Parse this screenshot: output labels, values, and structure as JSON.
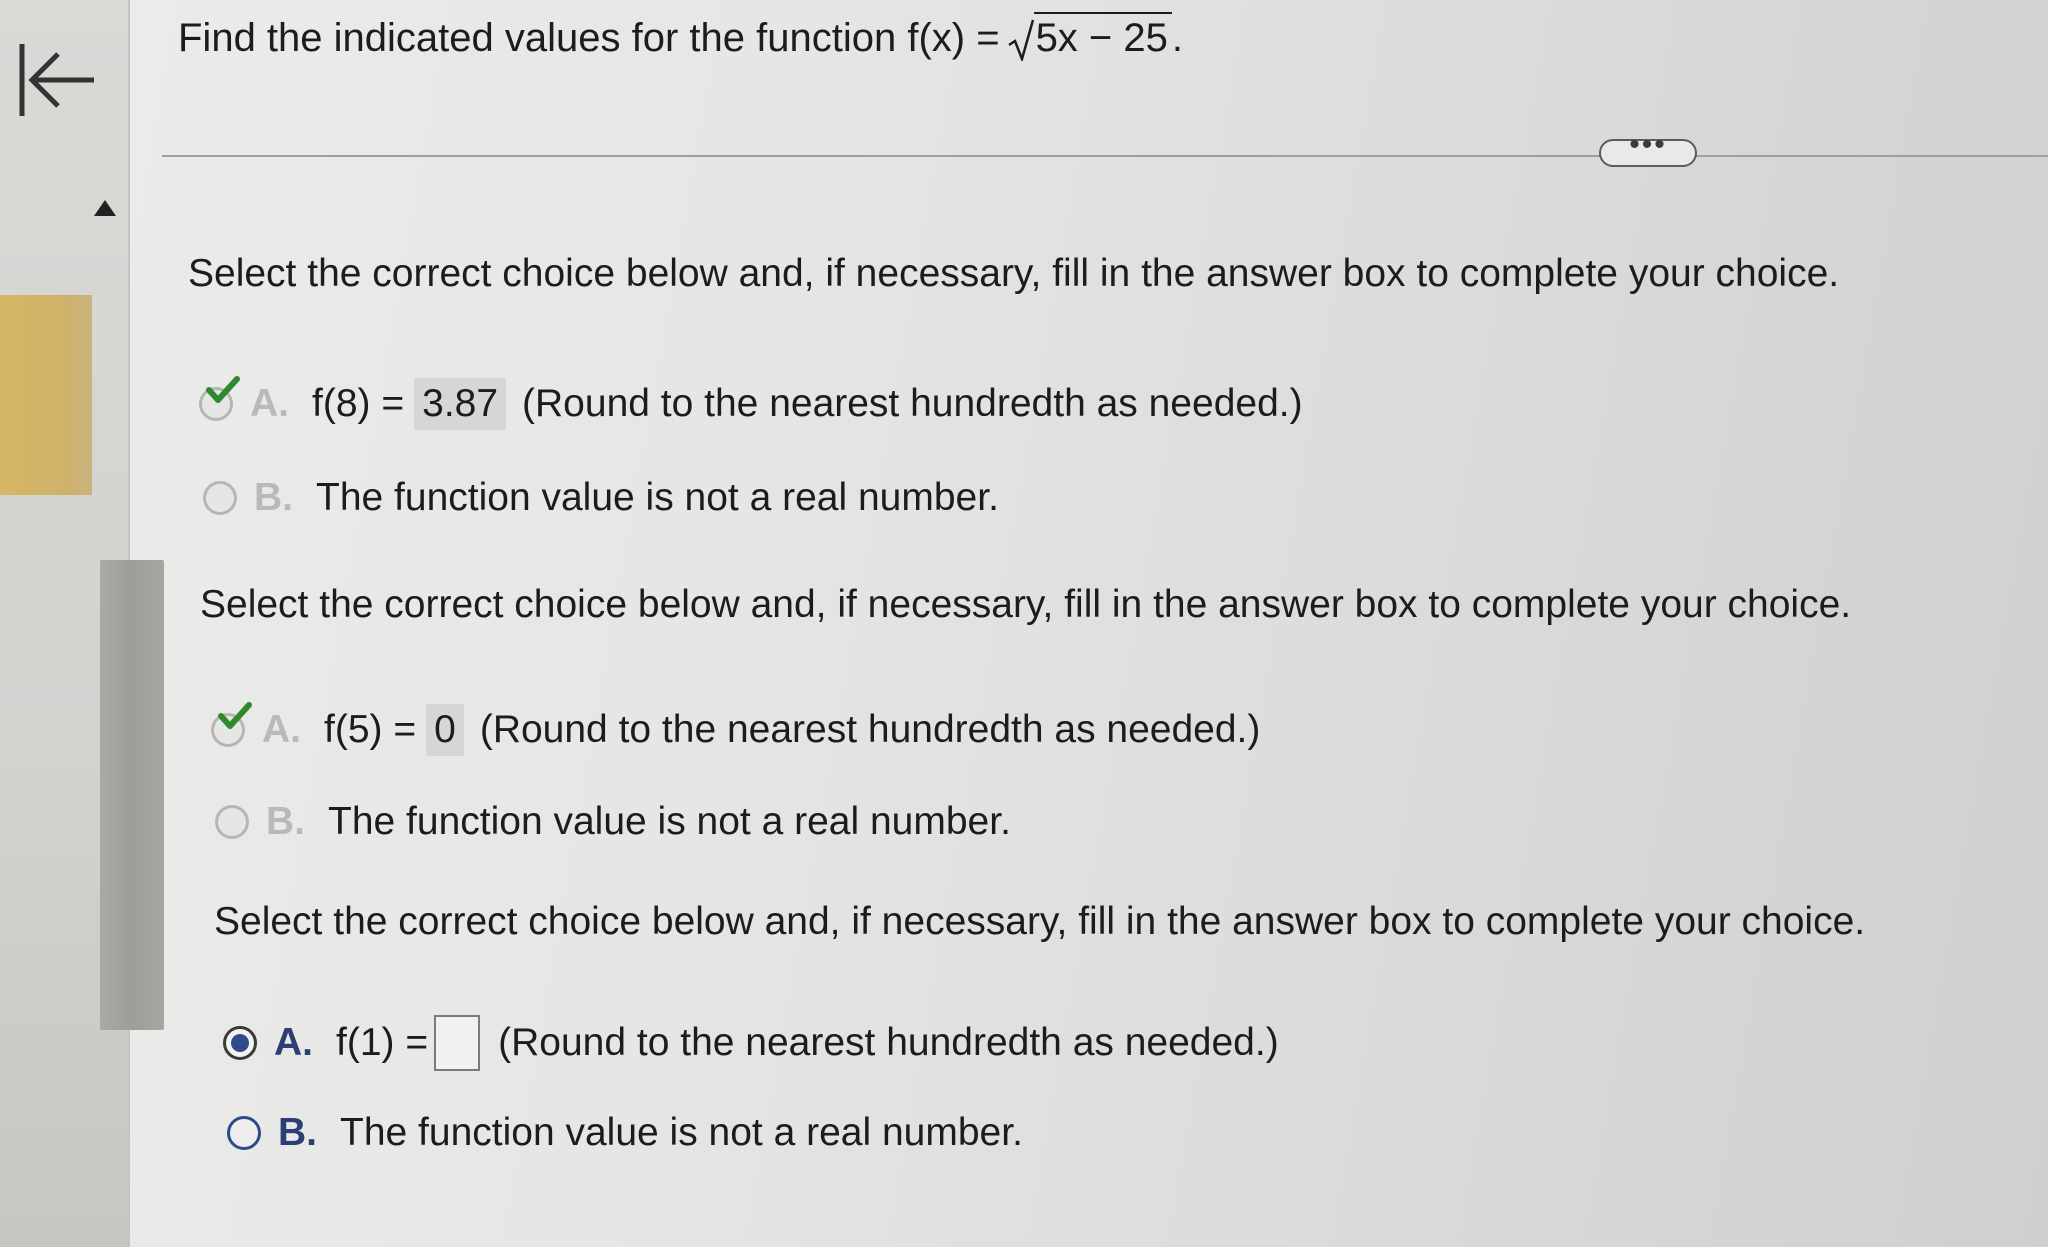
{
  "question": {
    "title_prefix": "Find the indicated values for the function f(x) = ",
    "radicand": "5x − 25",
    "title_suffix": "."
  },
  "more_button": {
    "label": "•••"
  },
  "parts": [
    {
      "instruction": "Select the correct choice below and, if necessary, fill in the answer box to complete your choice.",
      "choice_a": {
        "letter": "A.",
        "expr": "f(8) =",
        "answer": "3.87",
        "hint": "(Round to the nearest hundredth as needed.)",
        "state": "correct"
      },
      "choice_b": {
        "letter": "B.",
        "text": "The function value is not a real number."
      }
    },
    {
      "instruction": "Select the correct choice below and, if necessary, fill in the answer box to complete your choice.",
      "choice_a": {
        "letter": "A.",
        "expr": "f(5) =",
        "answer": "0",
        "hint": "(Round to the nearest hundredth as needed.)",
        "state": "correct"
      },
      "choice_b": {
        "letter": "B.",
        "text": "The function value is not a real number."
      }
    },
    {
      "instruction": "Select the correct choice below and, if necessary, fill in the answer box to complete your choice.",
      "choice_a": {
        "letter": "A.",
        "expr": "f(1) =",
        "answer": "",
        "hint": "(Round to the nearest hundredth as needed.)",
        "state": "selected"
      },
      "choice_b": {
        "letter": "B.",
        "text": "The function value is not a real number."
      }
    }
  ],
  "colors": {
    "accent_blue": "#2f4b8c",
    "check_green": "#2f8a2f",
    "sidebar_yellow": "#d6b765"
  },
  "icons": {
    "back": "arrow-left-to-bar-icon",
    "scroll_up": "triangle-up-icon",
    "check": "checkmark-icon"
  }
}
